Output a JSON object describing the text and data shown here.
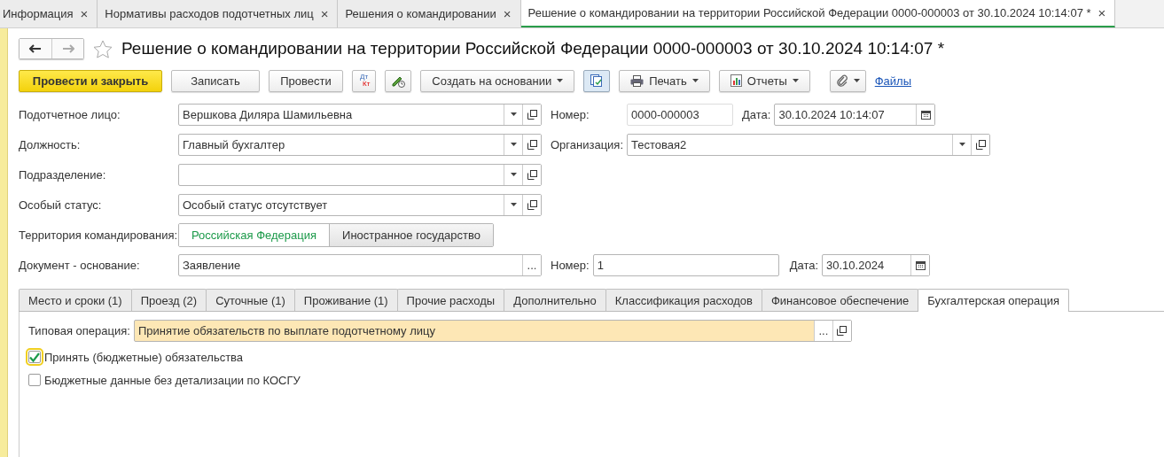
{
  "open_tabs": [
    {
      "label": "Информация",
      "selected": false
    },
    {
      "label": "Нормативы расходов подотчетных лиц",
      "selected": false
    },
    {
      "label": "Решения о командировании",
      "selected": false
    },
    {
      "label": "Решение о командировании на территории Российской Федерации 0000-000003 от 30.10.2024 10:14:07 *",
      "selected": true
    }
  ],
  "close_mark": "×",
  "title": "Решение о командировании на территории Российской Федерации 0000-000003 от 30.10.2024 10:14:07 *",
  "toolbar": {
    "primary": "Провести и закрыть",
    "write": "Записать",
    "post": "Провести",
    "dt": "Дт",
    "kt": "Кт",
    "create": "Создать на основании",
    "print": "Печать",
    "reports": "Отчеты",
    "files": "Файлы"
  },
  "fields": [
    {
      "label": "Подотчетное лицо:",
      "value": "Вершкова Диляра Шамильевна"
    },
    {
      "label": "Должность:",
      "value": "Главный бухгалтер"
    },
    {
      "label": "Подразделение:"
    },
    {
      "label": "Особый статус:",
      "value": "Особый статус отсутствует"
    }
  ],
  "number": {
    "label": "Номер:",
    "value": "0000-000003"
  },
  "date": {
    "label": "Дата:",
    "value": "30.10.2024 10:14:07"
  },
  "organization": {
    "label": "Организация:",
    "value": "Тестовая2"
  },
  "territory": {
    "label": "Территория командирования:",
    "options": [
      {
        "label": "Российская Федерация",
        "selected": true
      },
      {
        "label": "Иностранное государство",
        "selected": false
      }
    ]
  },
  "basis": {
    "label": "Документ - основание:",
    "value": "Заявление",
    "choose": "...",
    "number_label": "Номер:",
    "number": "1",
    "date_label": "Дата:",
    "date": "30.10.2024"
  },
  "form_tabs": [
    {
      "label": "Место и сроки (1)",
      "selected": false
    },
    {
      "label": "Проезд (2)",
      "selected": false
    },
    {
      "label": "Суточные (1)",
      "selected": false
    },
    {
      "label": "Проживание (1)",
      "selected": false
    },
    {
      "label": "Прочие расходы",
      "selected": false
    },
    {
      "label": "Дополнительно",
      "selected": false
    },
    {
      "label": "Классификация расходов",
      "selected": false
    },
    {
      "label": "Финансовое обеспечение",
      "selected": false
    },
    {
      "label": "Бухгалтерская операция",
      "selected": true
    }
  ],
  "operation": {
    "label": "Типовая операция:",
    "value": "Принятие обязательств по выплате подотчетному лицу",
    "choose": "..."
  },
  "checkboxes": [
    {
      "label": "Принять (бюджетные) обязательства",
      "checked": true,
      "focused": true
    },
    {
      "label": "Бюджетные данные без детализации по КОСГУ",
      "checked": false,
      "focused": false
    }
  ]
}
